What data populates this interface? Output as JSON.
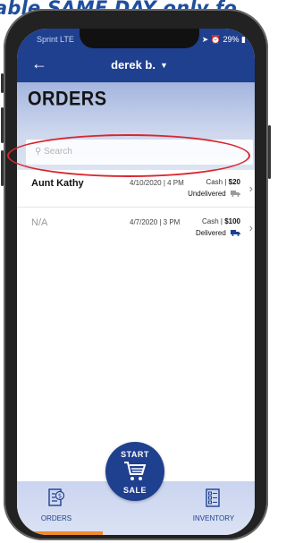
{
  "banner": {
    "text": "able SAME DAY only fo"
  },
  "status_bar": {
    "carrier": "Sprint LTE",
    "right": "29%"
  },
  "header": {
    "back_icon": "arrow-left-icon",
    "user_name": "derek b."
  },
  "page": {
    "title": "ORDERS",
    "search_placeholder": "Search"
  },
  "orders": [
    {
      "name": "Aunt Kathy",
      "date": "4/10/2020 | 4 PM",
      "payment": "Cash | ",
      "amount": "$20",
      "status": "Undelivered",
      "status_icon": "truck-icon",
      "status_color": "#9a9a9a",
      "highlighted": true
    },
    {
      "name": "N/A",
      "date": "4/7/2020 | 3 PM",
      "payment": "Cash | ",
      "amount": "$100",
      "status": "Delivered",
      "status_icon": "truck-icon",
      "status_color": "#1f3f8f",
      "highlighted": false
    }
  ],
  "nav": {
    "orders_label": "ORDERS",
    "inventory_label": "INVENTORY"
  },
  "fab": {
    "line1": "START",
    "line2": "SALE"
  },
  "colors": {
    "primary": "#1f3f8f",
    "accent": "#f08a2e",
    "highlight": "#d8262f"
  }
}
